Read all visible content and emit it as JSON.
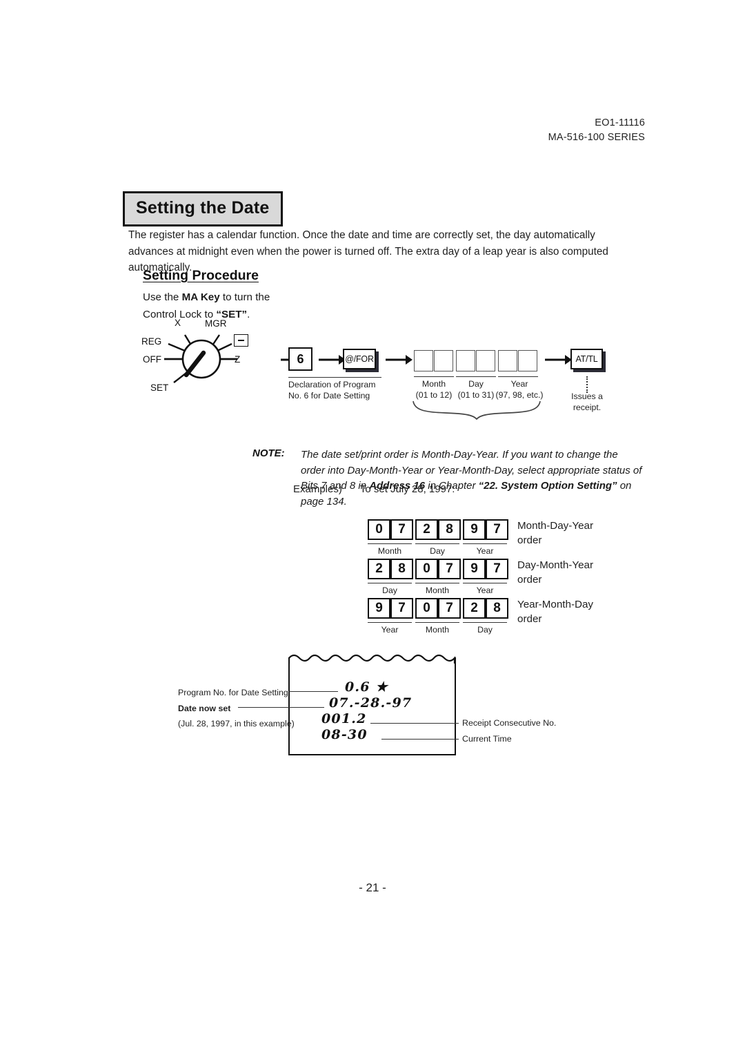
{
  "header": {
    "doc_code": "EO1-11116",
    "series": "MA-516-100 SERIES"
  },
  "section": {
    "title": "Setting the Date",
    "intro": "The register has a calendar function. Once the date and time are correctly set, the day automatically advances at midnight even when the power is turned off. The extra day of a leap year is also computed automatically.",
    "sub_heading": "Setting Procedure"
  },
  "procedure": {
    "instruction_pre": "Use the ",
    "instruction_key": "MA Key",
    "instruction_mid": " to turn the",
    "instruction_line2_pre": "Control Lock to ",
    "instruction_line2_key": "“SET”",
    "instruction_line2_post": ".",
    "dial": {
      "labels": {
        "x": "X",
        "mgr": "MGR",
        "reg": "REG",
        "off": "OFF",
        "set": "SET",
        "z": "Z"
      },
      "ma_key_glyph": "minus-key-icon"
    },
    "keys": {
      "program_number": "6",
      "for_key": "@/FOR",
      "total_key": "AT/TL"
    },
    "captions": {
      "declaration_line1": "Declaration of Program",
      "declaration_line2": "No. 6 for Date Setting",
      "month": "Month",
      "month_range": "(01 to 12)",
      "day": "Day",
      "day_range": "(01 to 31)",
      "year": "Year",
      "year_range": "(97, 98, etc.)",
      "issues_line1": "Issues a",
      "issues_line2": "receipt."
    },
    "entry_boxes_count": 6
  },
  "note": {
    "label": "NOTE:",
    "text_part1": "The date set/print order is Month-Day-Year. If you want to change the order into Day-Month-Year or Year-Month-Day, select appropriate status of Bits 7 and 8 in ",
    "text_bold1": "Address 16",
    "text_part2": " in Chapter ",
    "text_bold2": "“22. System Option Setting”",
    "text_part3": " on page 134."
  },
  "examples": {
    "label": "Examples)",
    "intro": "To set July 28, 1997:",
    "rows": [
      {
        "digits": [
          "0",
          "7",
          "2",
          "8",
          "9",
          "7"
        ],
        "group_labels": [
          "Month",
          "Day",
          "Year"
        ],
        "order_line1": "Month-Day-Year",
        "order_line2": "order"
      },
      {
        "digits": [
          "2",
          "8",
          "0",
          "7",
          "9",
          "7"
        ],
        "group_labels": [
          "Day",
          "Month",
          "Year"
        ],
        "order_line1": "Day-Month-Year",
        "order_line2": "order"
      },
      {
        "digits": [
          "9",
          "7",
          "0",
          "7",
          "2",
          "8"
        ],
        "group_labels": [
          "Year",
          "Month",
          "Day"
        ],
        "order_line1": "Year-Month-Day",
        "order_line2": "order"
      }
    ]
  },
  "receipt": {
    "lines": [
      "0.6 ★",
      "07.-28.-97",
      "001.2",
      "08-30"
    ],
    "callouts": {
      "program_no": "Program No. for Date Setting",
      "date_now_set": "Date now set",
      "date_example": "(Jul. 28, 1997, in this example)",
      "consecutive_no": "Receipt Consecutive No.",
      "current_time": "Current Time"
    }
  },
  "footer": {
    "page_number": "- 21 -"
  }
}
